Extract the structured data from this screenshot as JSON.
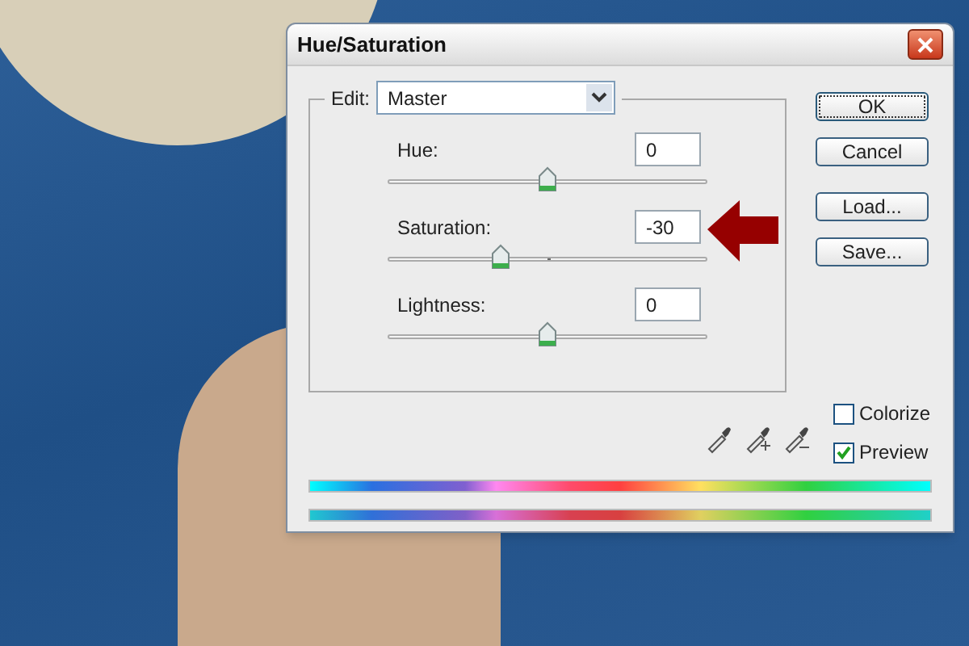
{
  "window": {
    "title": "Hue/Saturation"
  },
  "edit": {
    "label": "Edit:",
    "value": "Master"
  },
  "sliders": [
    {
      "label": "Hue:",
      "value": "0",
      "level": 0.5
    },
    {
      "label": "Saturation:",
      "value": "-30",
      "level": 0.35
    },
    {
      "label": "Lightness:",
      "value": "0",
      "level": 0.5
    }
  ],
  "buttons": [
    {
      "label": "OK",
      "default": true
    },
    {
      "label": "Cancel",
      "default": false
    },
    {
      "label": "Load...",
      "default": false
    },
    {
      "label": "Save...",
      "default": false
    }
  ],
  "checkboxes": [
    {
      "label": "Colorize",
      "checked": false
    },
    {
      "label": "Preview",
      "checked": true
    }
  ]
}
